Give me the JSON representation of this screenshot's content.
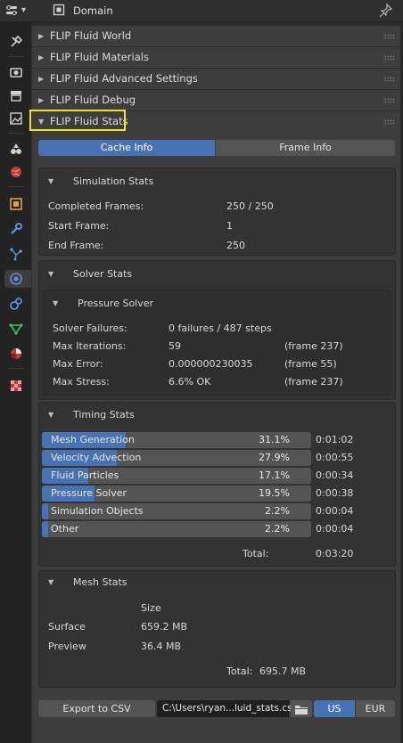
{
  "header": {
    "context_label": "Domain"
  },
  "panels": [
    {
      "label": "FLIP Fluid World",
      "expanded": false
    },
    {
      "label": "FLIP Fluid Materials",
      "expanded": false
    },
    {
      "label": "FLIP Fluid Advanced Settings",
      "expanded": false
    },
    {
      "label": "FLIP Fluid Debug",
      "expanded": false
    },
    {
      "label": "FLIP Fluid Stats",
      "expanded": true
    }
  ],
  "highlight_color": "#f0e61a",
  "accent_color": "#4772b3",
  "tabs": {
    "cache_info": "Cache Info",
    "frame_info": "Frame Info",
    "selected": "cache_info"
  },
  "simulation_stats": {
    "title": "Simulation Stats",
    "rows": [
      {
        "label": "Completed Frames:",
        "value": "250  /  250"
      },
      {
        "label": "Start Frame:",
        "value": "1"
      },
      {
        "label": "End Frame:",
        "value": "250"
      }
    ]
  },
  "solver_stats": {
    "title": "Solver Stats",
    "pressure_title": "Pressure Solver",
    "rows": [
      {
        "label": "Solver Failures:",
        "value": "0 failures / 487 steps",
        "extra": ""
      },
      {
        "label": "Max Iterations:",
        "value": "59",
        "extra": "(frame 237)"
      },
      {
        "label": "Max Error:",
        "value": "0.000000230035",
        "extra": "(frame 55)"
      },
      {
        "label": "Max Stress:",
        "value": "6.6%   OK",
        "extra": "(frame 237)"
      }
    ]
  },
  "timing_stats": {
    "title": "Timing Stats",
    "rows": [
      {
        "label": "Mesh Generation",
        "percent": "31.1%",
        "time": "0:01:02",
        "fill": 0.311
      },
      {
        "label": "Velocity Advection",
        "percent": "27.9%",
        "time": "0:00:55",
        "fill": 0.279
      },
      {
        "label": "Fluid Particles",
        "percent": "17.1%",
        "time": "0:00:34",
        "fill": 0.171
      },
      {
        "label": "Pressure Solver",
        "percent": "19.5%",
        "time": "0:00:38",
        "fill": 0.195
      },
      {
        "label": "Simulation Objects",
        "percent": "2.2%",
        "time": "0:00:04",
        "fill": 0.022
      },
      {
        "label": "Other",
        "percent": "2.2%",
        "time": "0:00:04",
        "fill": 0.022
      }
    ],
    "total_label": "Total:",
    "total_value": "0:03:20"
  },
  "mesh_stats": {
    "title": "Mesh Stats",
    "size_header": "Size",
    "rows": [
      {
        "label": "Surface",
        "value": "659.2 MB"
      },
      {
        "label": "Preview",
        "value": "36.4 MB"
      }
    ],
    "total_label": "Total:",
    "total_value": "695.7 MB"
  },
  "export": {
    "button_label": "Export to CSV",
    "path": "C:\\Users\\ryan...luid_stats.csv",
    "locale_us": "US",
    "locale_eur": "EUR",
    "selected_locale": "US"
  }
}
